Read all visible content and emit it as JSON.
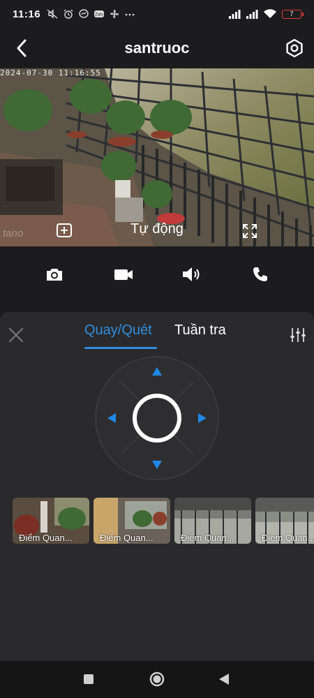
{
  "status_bar": {
    "time": "11:16",
    "battery": "7",
    "icons_left": [
      "mute-icon",
      "alarm-icon",
      "messenger-icon",
      "zalo-icon",
      "fan-icon",
      "more-icon"
    ],
    "icons_right": [
      "signal-icon",
      "signal-icon",
      "wifi-icon",
      "battery-icon"
    ]
  },
  "header": {
    "title": "santruoc",
    "back_icon": "chevron-left-icon",
    "settings_icon": "hexagon-gear-icon"
  },
  "video": {
    "timestamp": "2024-07-30 11:16:55",
    "watermark": "tano",
    "mode_label": "Tự động",
    "zoom_icon": "add-box-icon",
    "fullscreen_icon": "fullscreen-icon"
  },
  "toolbar": {
    "icons": [
      "camera-icon",
      "video-record-icon",
      "speaker-icon",
      "phone-icon"
    ]
  },
  "panel": {
    "tabs": [
      {
        "label": "Quay/Quét",
        "active": true
      },
      {
        "label": "Tuần tra",
        "active": false
      }
    ],
    "close_icon": "close-icon",
    "adjust_icon": "sliders-icon",
    "joystick": {
      "arrows": [
        "arrow-up-icon",
        "arrow-down-icon",
        "arrow-left-icon",
        "arrow-right-icon"
      ],
      "accent": "#1e88e5"
    },
    "presets": [
      {
        "label": "Điểm Quan..."
      },
      {
        "label": "Điểm Quan..."
      },
      {
        "label": "Điểm Quan..."
      },
      {
        "label": "Điểm Quan..."
      }
    ]
  },
  "nav_bar": {
    "icons": [
      "recent-apps-icon",
      "home-icon",
      "back-icon"
    ]
  },
  "colors": {
    "accent": "#2f8fe0",
    "background": "#1c1c1e",
    "panel": "#2a2a2c"
  }
}
